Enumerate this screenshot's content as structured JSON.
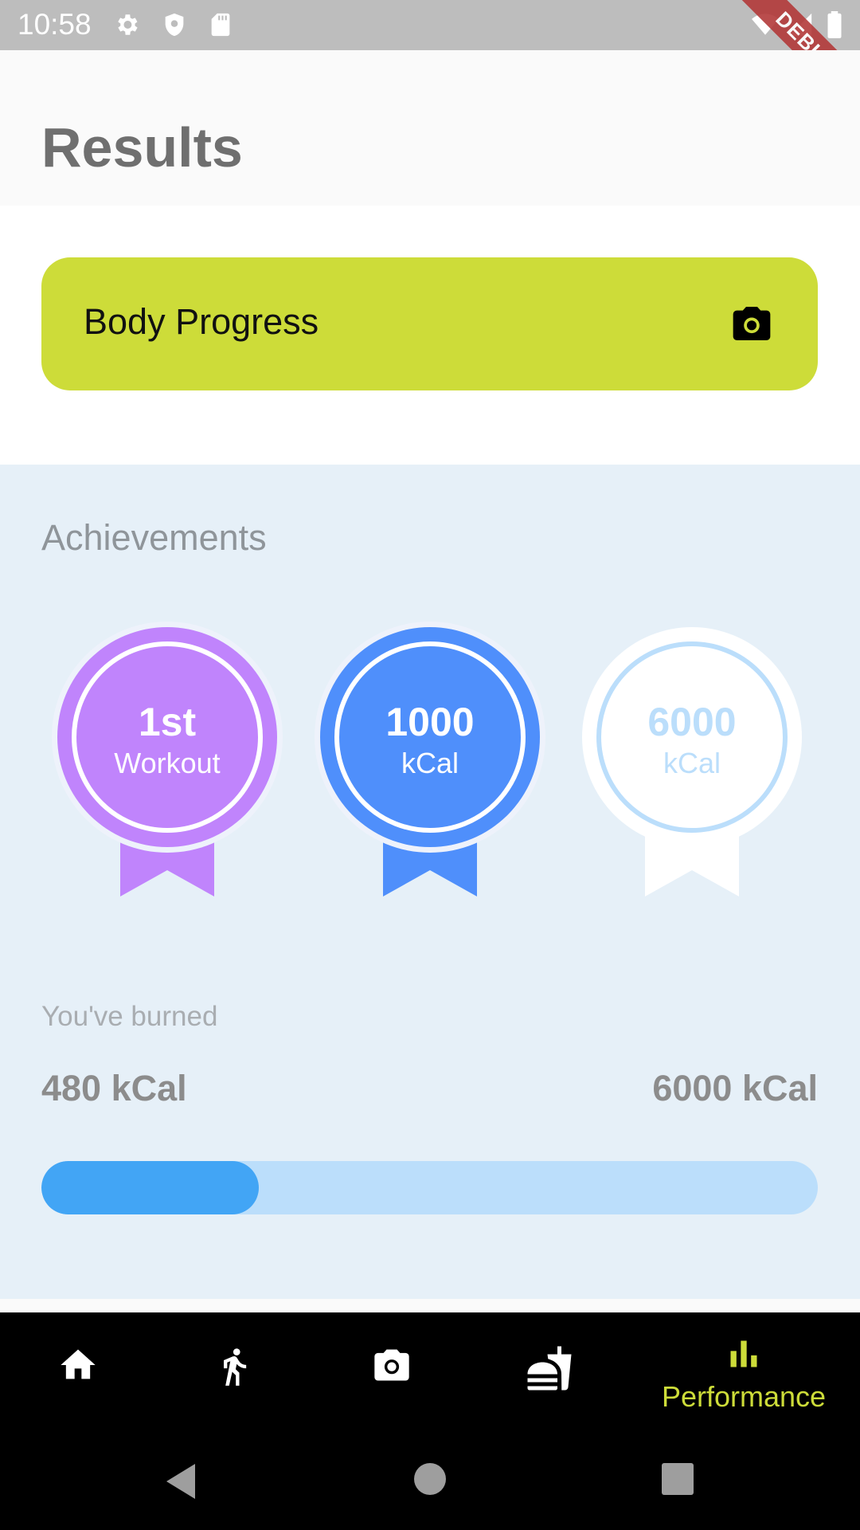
{
  "status_bar": {
    "time": "10:58",
    "icons": [
      "gear-icon",
      "shield-icon",
      "sd-card-icon",
      "wifi-icon",
      "signal-icon",
      "battery-icon"
    ],
    "debug_banner": "DEBUG"
  },
  "header": {
    "title": "Results"
  },
  "body_progress": {
    "label": "Body Progress",
    "icon": "camera-icon",
    "color": "#cddc39"
  },
  "achievements": {
    "title": "Achievements",
    "medals": [
      {
        "top": "1st",
        "bottom": "Workout",
        "color": "#c084fc",
        "earned": true
      },
      {
        "top": "1000",
        "bottom": "kCal",
        "color": "#4f8ffb",
        "earned": true
      },
      {
        "top": "6000",
        "bottom": "kCal",
        "color": "#bbdefb",
        "earned": false
      }
    ]
  },
  "burned": {
    "label": "You've burned",
    "current": "480 kCal",
    "goal": "6000 kCal",
    "progress_fraction": 0.28
  },
  "bottom_nav": {
    "items": [
      {
        "icon": "home-icon",
        "label": ""
      },
      {
        "icon": "running-icon",
        "label": ""
      },
      {
        "icon": "camera-icon",
        "label": ""
      },
      {
        "icon": "fastfood-icon",
        "label": ""
      },
      {
        "icon": "bar-chart-icon",
        "label": "Performance",
        "active": true
      }
    ],
    "active_color": "#cddc39"
  },
  "android_nav": [
    "back-icon",
    "home-circle-icon",
    "recents-icon"
  ]
}
